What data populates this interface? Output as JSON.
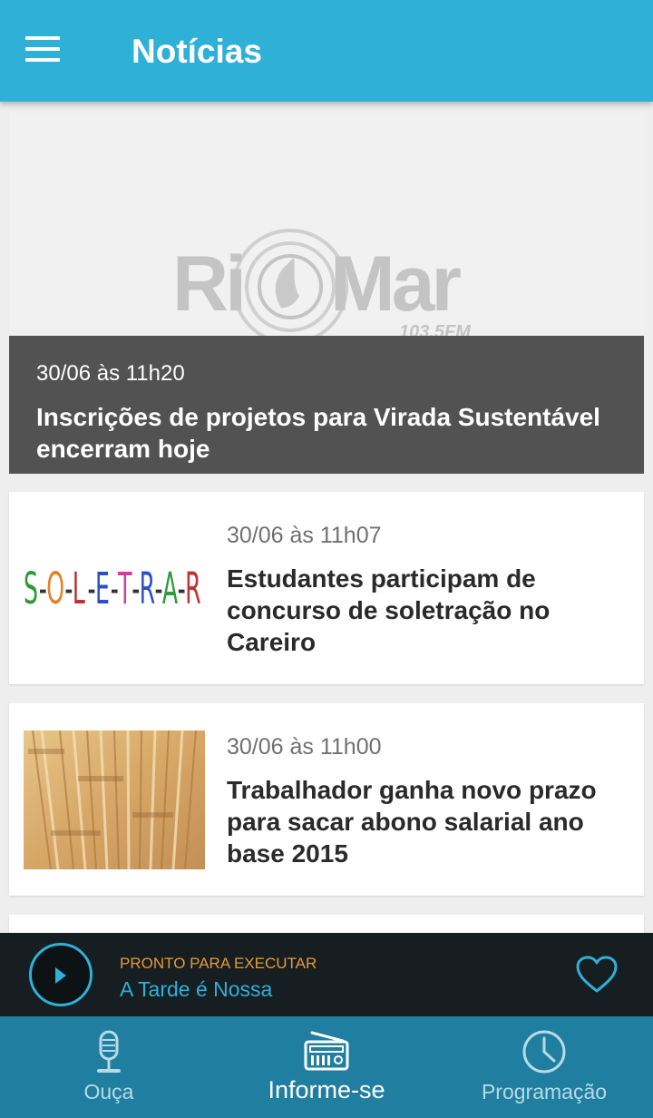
{
  "appbar": {
    "title": "Notícias",
    "menu_icon": "hamburger-menu-icon"
  },
  "featured": {
    "logo_text": "RioMar",
    "logo_sub": "103,5FM",
    "date": "30/06 às 11h20",
    "title": "Inscrições de projetos para Virada Sustentável encerram hoje"
  },
  "news": [
    {
      "date": "30/06 às 11h07",
      "title": "Estudantes participam de concurso de soletração no Careiro",
      "thumb_text": "S-O-L-E-T-R-A-R"
    },
    {
      "date": "30/06 às 11h00",
      "title": "Trabalhador ganha novo prazo para sacar abono salarial ano base 2015",
      "thumb_icon": "banknotes-image"
    }
  ],
  "player": {
    "status": "PRONTO PARA EXECUTAR",
    "program": "A Tarde é Nossa",
    "play_icon": "play-icon",
    "favorite_icon": "heart-icon"
  },
  "bottom_nav": [
    {
      "label": "Ouça",
      "icon": "microphone-icon"
    },
    {
      "label": "Informe-se",
      "icon": "radio-icon",
      "active": true
    },
    {
      "label": "Programação",
      "icon": "clock-icon"
    }
  ],
  "colors": {
    "accent": "#2fb0d6",
    "nav_bg": "#207fa0",
    "player_bg": "#171e22",
    "status_orange": "#e39a3a"
  }
}
